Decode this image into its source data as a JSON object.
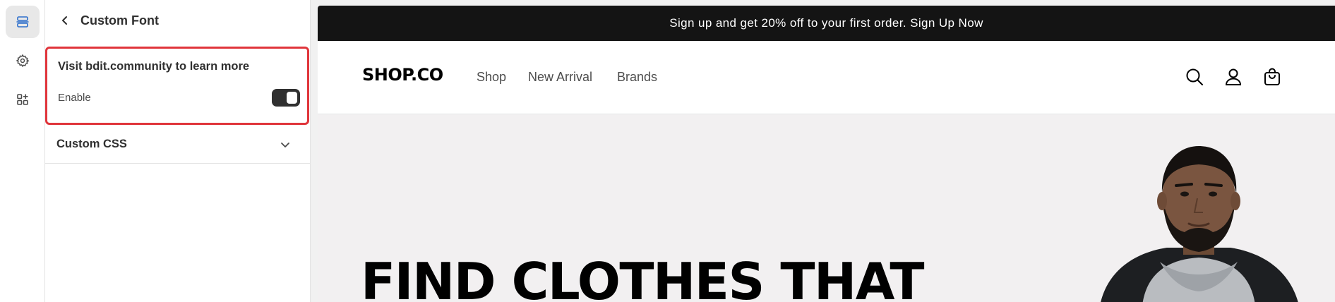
{
  "rail": {
    "items": [
      {
        "name": "sections-icon",
        "active": true
      },
      {
        "name": "settings-icon",
        "active": false
      },
      {
        "name": "apps-icon",
        "active": false
      }
    ]
  },
  "panel": {
    "title": "Custom Font",
    "card": {
      "heading": "Visit bdit.community to learn more",
      "enable_label": "Enable",
      "enabled": true
    },
    "accordion": {
      "label": "Custom CSS"
    }
  },
  "preview": {
    "announcement": "Sign up and get 20% off to your first order. Sign Up Now",
    "logo": "SHOP.CO",
    "nav": [
      "Shop",
      "New Arrival",
      "Brands"
    ],
    "header_icons": [
      "search-icon",
      "account-icon",
      "cart-icon"
    ],
    "hero_title": "FIND CLOTHES THAT"
  },
  "colors": {
    "highlight_border": "#e0353b",
    "announcement_bg": "#141414",
    "hero_bg": "#f2f0f1",
    "toggle_on": "#303030"
  }
}
